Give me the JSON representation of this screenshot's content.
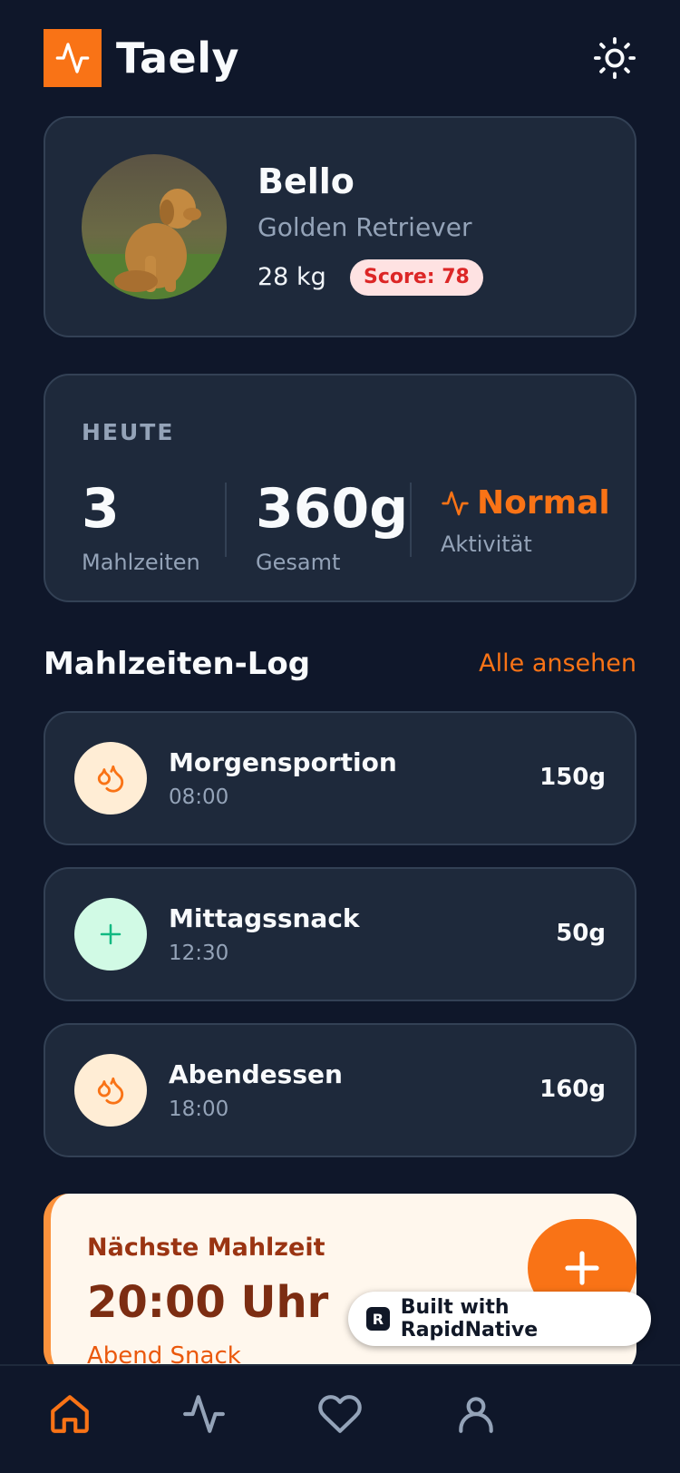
{
  "app": {
    "name": "Taely"
  },
  "pet": {
    "name": "Bello",
    "breed": "Golden Retriever",
    "weight": "28 kg",
    "score": "Score: 78"
  },
  "today": {
    "label": "HEUTE",
    "meals_count": "3",
    "meals_label": "Mahlzeiten",
    "total": "360g",
    "total_label": "Gesamt",
    "activity": "Normal",
    "activity_label": "Aktivität"
  },
  "meal_log": {
    "title": "Mahlzeiten-Log",
    "see_all": "Alle ansehen",
    "items": [
      {
        "name": "Morgensportion",
        "time": "08:00",
        "amount": "150g",
        "icon": "droplets-icon"
      },
      {
        "name": "Mittagssnack",
        "time": "12:30",
        "amount": "50g",
        "icon": "plus-icon"
      },
      {
        "name": "Abendessen",
        "time": "18:00",
        "amount": "160g",
        "icon": "droplets-icon"
      }
    ]
  },
  "next_meal": {
    "label": "Nächste Mahlzeit",
    "time": "20:00 Uhr",
    "name": "Abend Snack"
  },
  "badge": {
    "text": "Built with RapidNative"
  },
  "colors": {
    "accent": "#f97316",
    "background": "#0f172a",
    "card": "#1e293b",
    "score_bg": "#fee2e2",
    "score_text": "#dc2626"
  }
}
